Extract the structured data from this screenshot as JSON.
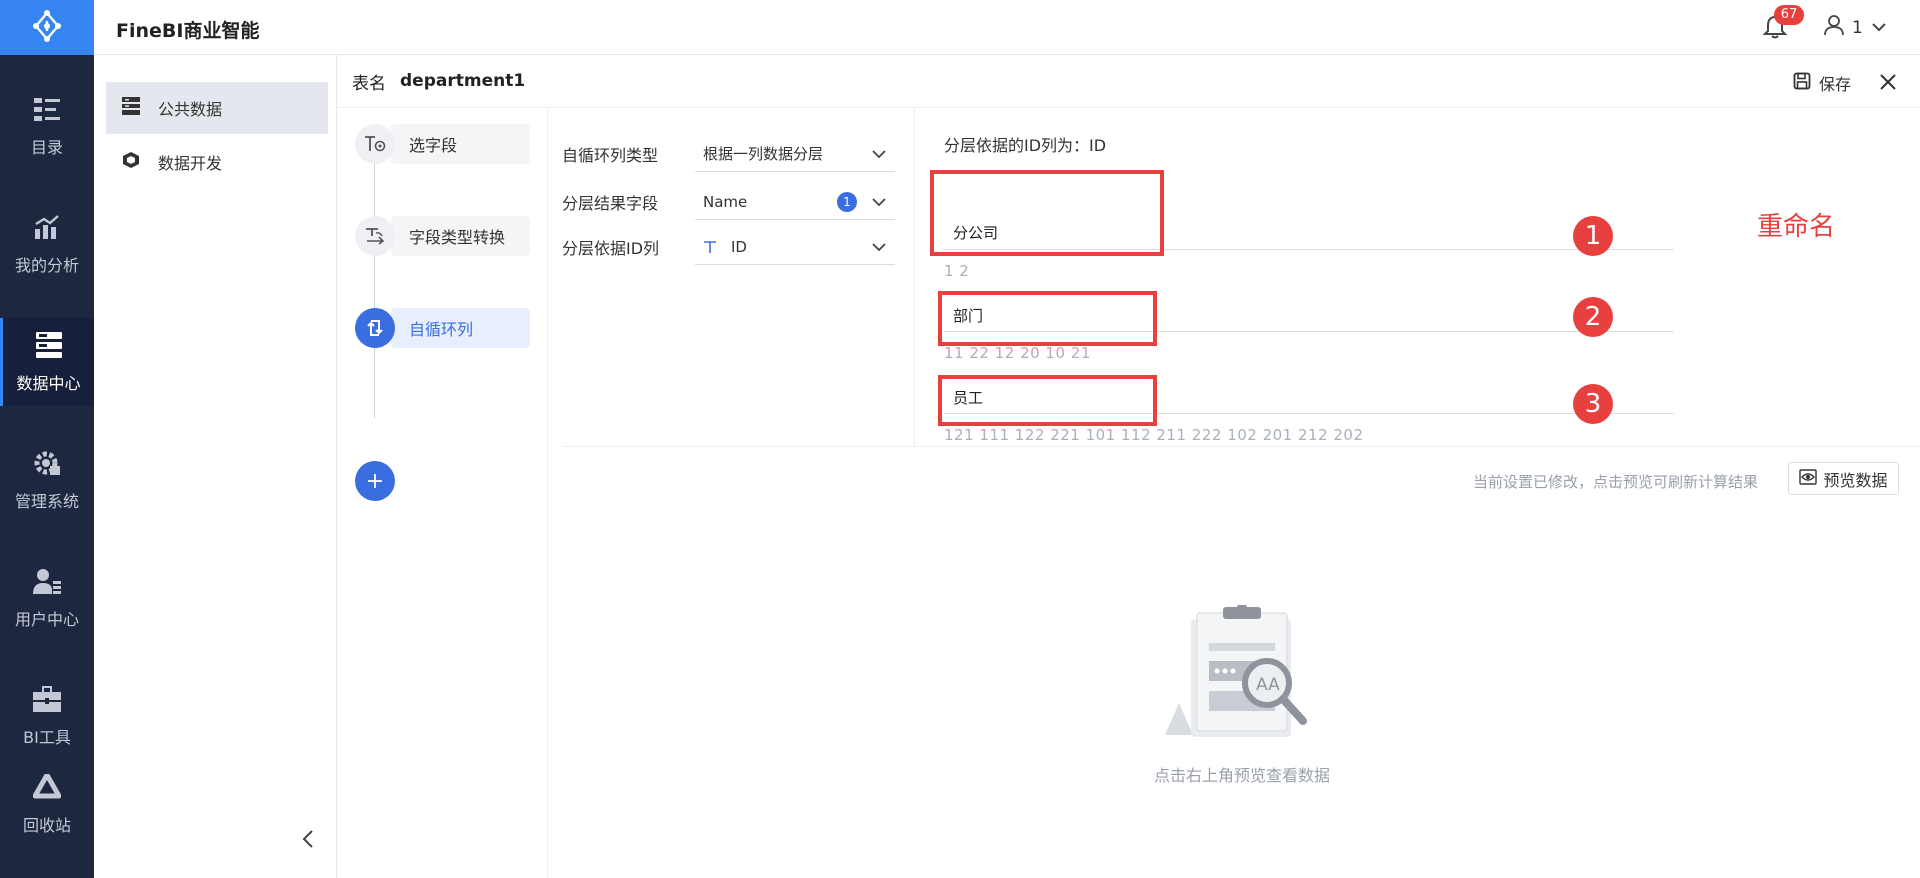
{
  "app": {
    "title": "FineBI商业智能"
  },
  "header": {
    "notification_count": "67",
    "user_name": "1"
  },
  "leftnav": {
    "items": [
      {
        "label": "目录",
        "icon": "catalog-icon"
      },
      {
        "label": "我的分析",
        "icon": "analysis-chart-icon"
      },
      {
        "label": "数据中心",
        "icon": "database-icon",
        "active": true
      },
      {
        "label": "管理系统",
        "icon": "gear-icon"
      },
      {
        "label": "用户中心",
        "icon": "user-card-icon"
      },
      {
        "label": "BI工具",
        "icon": "toolbox-icon"
      },
      {
        "label": "回收站",
        "icon": "recycle-icon"
      }
    ]
  },
  "sidebar": {
    "items": [
      {
        "label": "公共数据",
        "icon": "public-data-icon",
        "active": true
      },
      {
        "label": "数据开发",
        "icon": "cube-icon"
      }
    ]
  },
  "titlebar": {
    "label": "表名",
    "table_name": "department1",
    "save_label": "保存"
  },
  "steps": [
    {
      "label": "选字段",
      "icon": "field-select-icon"
    },
    {
      "label": "字段类型转换",
      "icon": "type-convert-icon"
    },
    {
      "label": "自循环列",
      "icon": "self-loop-icon",
      "active": true
    }
  ],
  "config": {
    "type_label": "自循环列类型",
    "type_value": "根据一列数据分层",
    "result_label": "分层结果字段",
    "result_value": "Name",
    "result_count": "1",
    "id_label": "分层依据ID列",
    "id_value": "ID"
  },
  "hierarchy": {
    "title": "分层依据的ID列为：ID",
    "levels": [
      {
        "name": "分公司",
        "ids": "1 2",
        "marker": "1"
      },
      {
        "name": "部门",
        "ids": "11  22  12  20  10  21",
        "marker": "2"
      },
      {
        "name": "员工",
        "ids": "121  111  122  221  101  112  211  222  102  201  212  202",
        "marker": "3"
      }
    ],
    "annotation": "重命名"
  },
  "preview": {
    "hint": "当前设置已修改，点击预览可刷新计算结果",
    "button_label": "预览数据",
    "empty_text": "点击右上角预览查看数据"
  },
  "colors": {
    "nav_bg": "#1d2740",
    "accent": "#3685f2",
    "step_active": "#3a6ee0",
    "annotation": "#e8403f"
  }
}
